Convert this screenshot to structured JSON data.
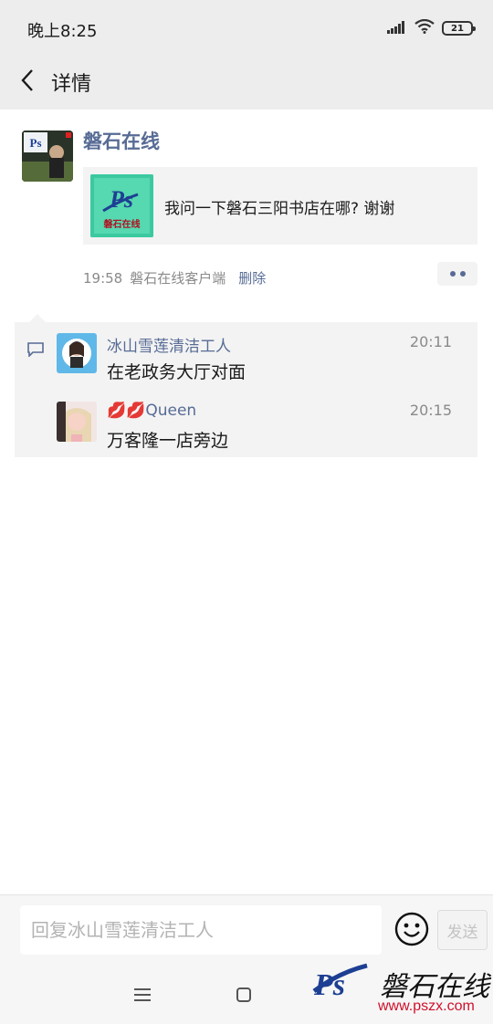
{
  "status_bar": {
    "time": "晚上8:25",
    "battery": "21",
    "signal_icon": "signal-icon",
    "wifi_icon": "wifi-icon"
  },
  "nav": {
    "back_icon": "back-chevron-icon",
    "title": "详情"
  },
  "post": {
    "author": "磐石在线",
    "link_card": {
      "title": "我问一下磐石三阳书店在哪? 谢谢",
      "thumb_logo_text": "磐石在线"
    },
    "time": "19:58",
    "source": "磐石在线客户端",
    "delete_label": "删除"
  },
  "comments": [
    {
      "name": "冰山雪莲清洁工人",
      "time": "20:11",
      "text": "在老政务大厅对面"
    },
    {
      "name": "💋💋Queen",
      "time": "20:15",
      "text": "万客隆一店旁边"
    }
  ],
  "reply": {
    "placeholder": "回复冰山雪莲清洁工人",
    "send_label": "发送",
    "emoji_icon": "smiley-icon"
  },
  "watermark": {
    "logo_text": "磐石在线",
    "url": "www.pszx.com"
  },
  "colors": {
    "link_blue": "#576b95",
    "bar_gray": "#ededed",
    "panel_gray": "#f3f3f3",
    "watermark_red": "#d0102a"
  }
}
